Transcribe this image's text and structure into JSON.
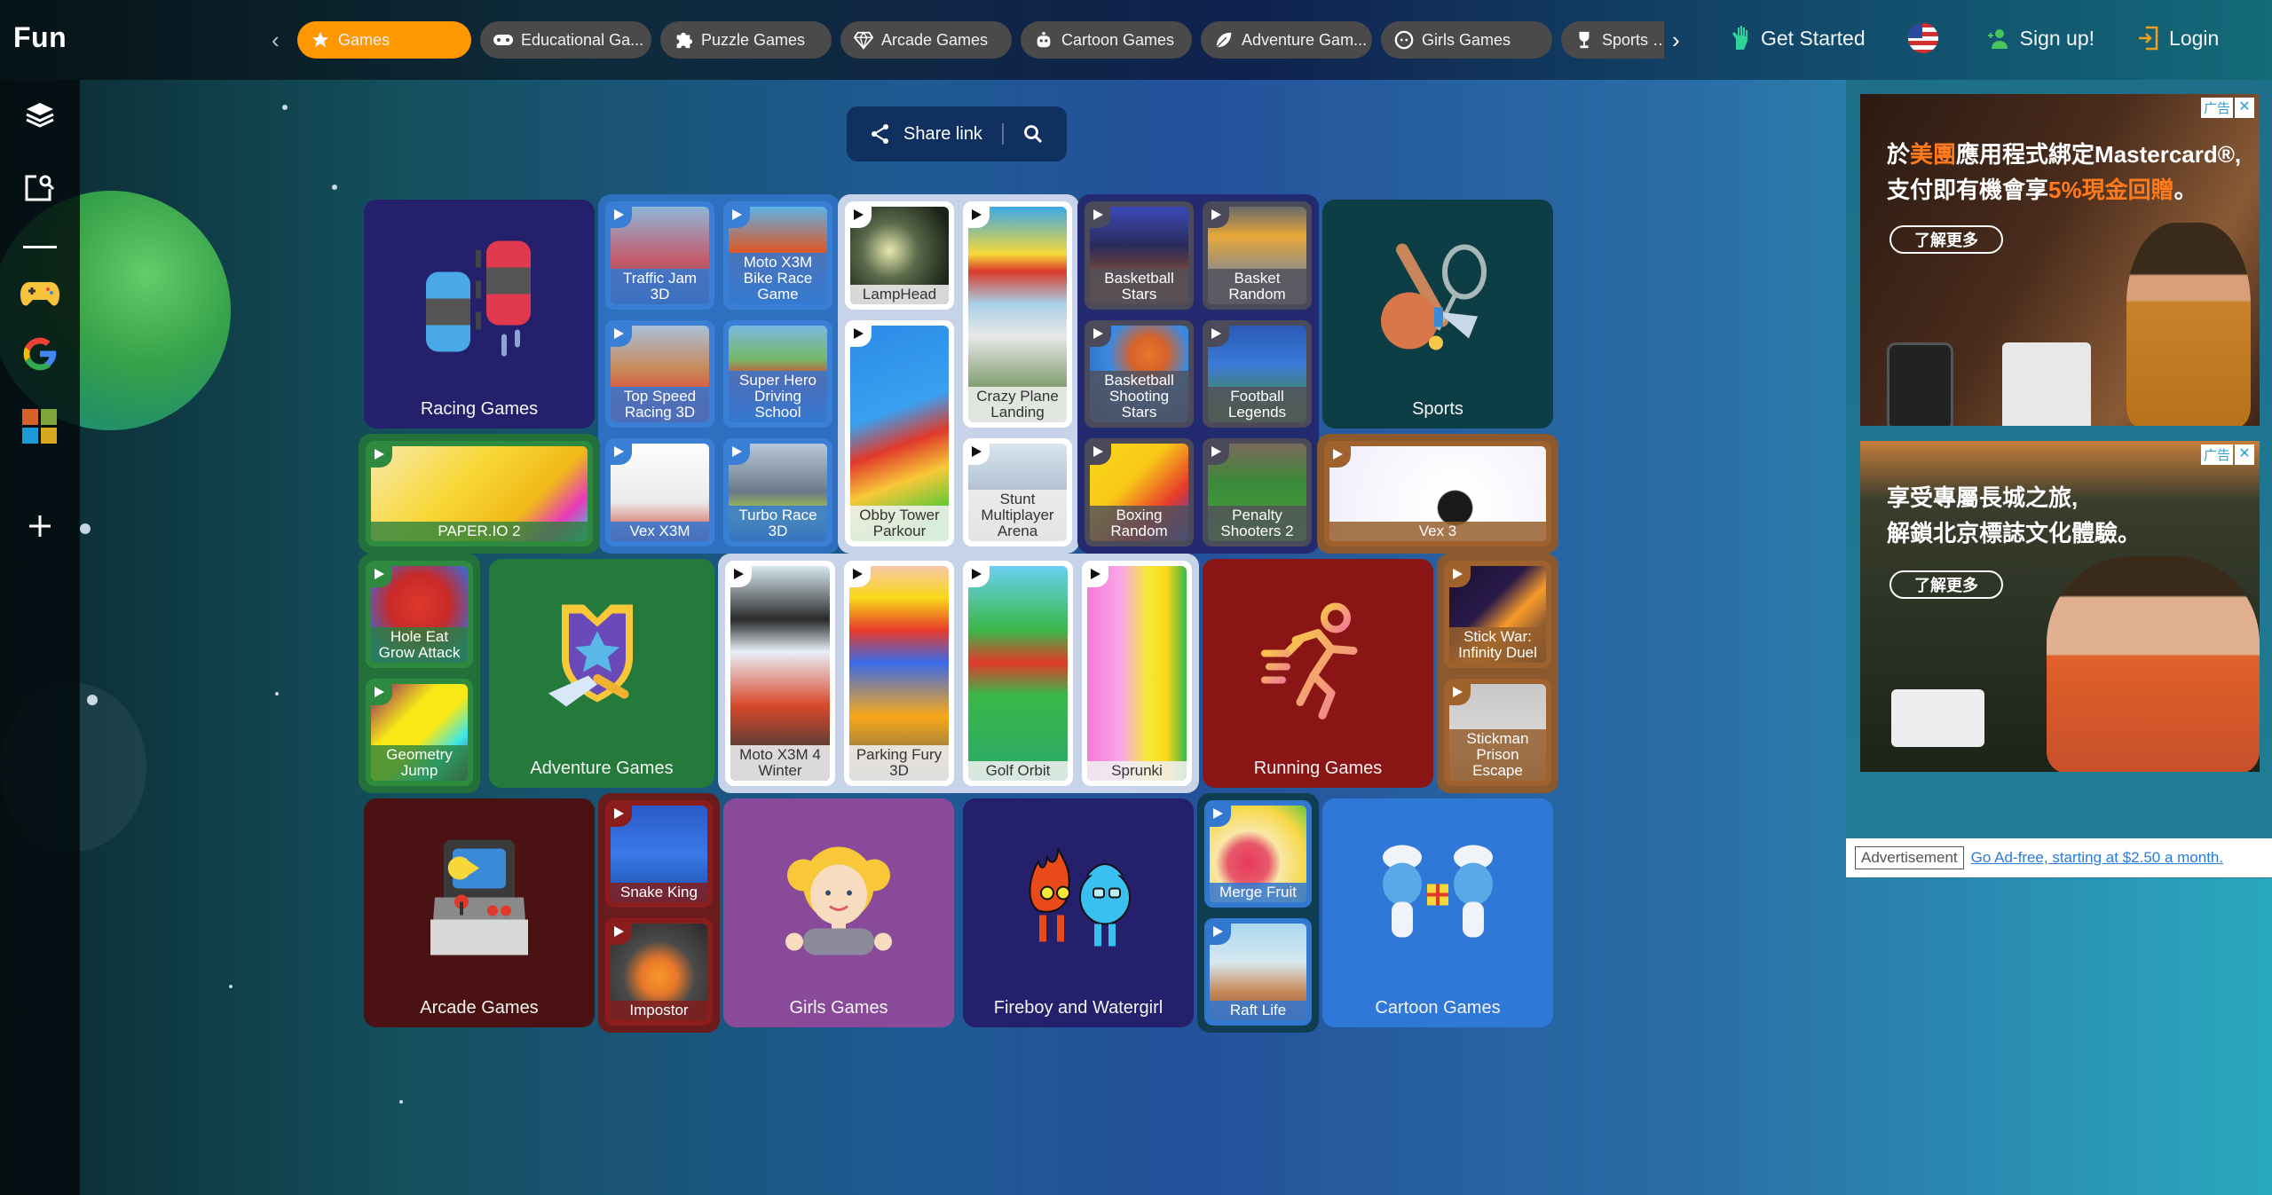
{
  "app": {
    "logo": "Fun"
  },
  "nav": {
    "tabs": [
      {
        "label": "Games",
        "icon": "star-icon",
        "active": true
      },
      {
        "label": "Educational Ga...",
        "icon": "gamepad-icon"
      },
      {
        "label": "Puzzle Games",
        "icon": "puzzle-icon"
      },
      {
        "label": "Arcade Games",
        "icon": "diamond-icon"
      },
      {
        "label": "Cartoon Games",
        "icon": "robot-icon"
      },
      {
        "label": "Adventure Gam...",
        "icon": "leaf-icon"
      },
      {
        "label": "Girls Games",
        "icon": "face-icon"
      },
      {
        "label": "Sports Gar",
        "icon": "trophy-icon"
      }
    ],
    "prev_arrow": "‹",
    "next_arrow": "›",
    "get_started": "Get Started",
    "sign_up": "Sign up!",
    "login": "Login",
    "language_flag": "us-flag"
  },
  "sidebar": {
    "items": [
      {
        "name": "layers-icon"
      },
      {
        "name": "search-page-icon"
      },
      {
        "name": "gamepad-icon"
      },
      {
        "name": "google-icon"
      },
      {
        "name": "microsoft-icon"
      },
      {
        "name": "plus-icon"
      }
    ]
  },
  "share": {
    "label": "Share link"
  },
  "grid": {
    "categories": {
      "racing": "Racing Games",
      "sports": "Sports",
      "adventure": "Adventure Games",
      "running": "Running Games",
      "arcade": "Arcade Games",
      "girls": "Girls Games",
      "fireboy": "Fireboy and Watergirl",
      "cartoon": "Cartoon Games"
    },
    "racing_group": [
      "Traffic Jam 3D",
      "Moto X3M Bike Race Game",
      "Top Speed Racing 3D",
      "Super Hero Driving School",
      "Vex X3M",
      "Turbo Race 3D"
    ],
    "light_group_1": {
      "lamphead": "LampHead",
      "crazy_plane": "Crazy Plane Landing",
      "obby": "Obby Tower Parkour",
      "stunt": "Stunt Multiplayer Arena"
    },
    "sports_group": [
      "Basketball Stars",
      "Basket Random",
      "Basketball Shooting Stars",
      "Football Legends",
      "Boxing Random",
      "Penalty Shooters 2"
    ],
    "paperio": "PAPER.IO 2",
    "vex3": "Vex 3",
    "green_group": [
      "Hole Eat Grow Attack",
      "Geometry Jump"
    ],
    "light_group_2": [
      "Moto X3M 4 Winter",
      "Parking Fury 3D",
      "Golf Orbit",
      "Sprunki"
    ],
    "brown_group": [
      "Stick War: Infinity Duel",
      "Stickman Prison Escape"
    ],
    "red_group": [
      "Snake King",
      "Impostor"
    ],
    "teal_group": [
      "Merge Fruit",
      "Raft Life"
    ]
  },
  "ads": {
    "tag": "广告",
    "close": "✕",
    "ad1": {
      "line1_pre": "於",
      "line1_hl": "美團",
      "line1_post": "應用程式綁定Mastercard®,",
      "line2_pre": "支付即有機會享",
      "line2_hl": "5%現金回贈",
      "line2_post": "。",
      "cta": "了解更多"
    },
    "ad2": {
      "line1": "享受專屬長城之旅,",
      "line2": "解鎖北京標誌文化體驗。",
      "cta": "了解更多"
    },
    "footer_label": "Advertisement",
    "footer_link": "Go Ad-free, starting at $2.50 a month."
  },
  "colors": {
    "accent": "#ff9800",
    "tab_bg": "#4a4a4a",
    "racing_cat": "#24206b",
    "sports_cat": "#0e3e45",
    "adventure_cat": "#237a3a",
    "running_cat": "#8a1515",
    "arcade_cat": "#4a1212",
    "girls_cat": "#8a4a9a",
    "cartoon_cat": "#2f78d8"
  }
}
